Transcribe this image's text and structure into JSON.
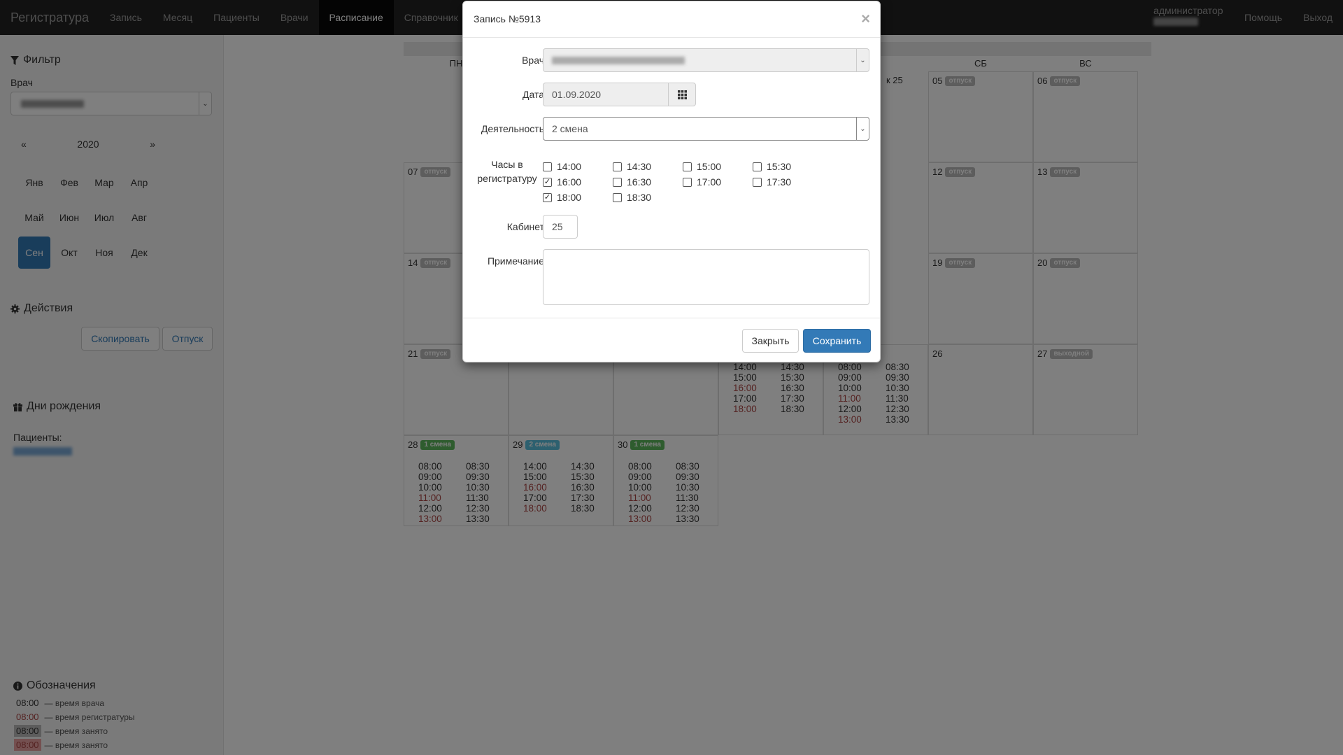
{
  "nav": {
    "brand": "Регистратура",
    "items": [
      "Запись",
      "Месяц",
      "Пациенты",
      "Врачи",
      "Расписание",
      "Справочник"
    ],
    "active": "Расписание",
    "user_role": "администратор",
    "help": "Помощь",
    "logout": "Выход"
  },
  "sidebar": {
    "filter_title": "Фильтр",
    "doctor_label": "Врач",
    "year": "2020",
    "prev": "«",
    "next": "»",
    "months": [
      "Янв",
      "Фев",
      "Мар",
      "Апр",
      "Май",
      "Июн",
      "Июл",
      "Авг",
      "Сен",
      "Окт",
      "Ноя",
      "Дек"
    ],
    "active_month": "Сен",
    "actions_title": "Действия",
    "copy_btn": "Скопировать",
    "vacation_btn": "Отпуск",
    "birthdays_title": "Дни рождения",
    "patients_label": "Пациенты:",
    "legend_title": "Обозначения",
    "legend": [
      {
        "time": "08:00",
        "text": "— время врача",
        "color": "#333333",
        "bg": ""
      },
      {
        "time": "08:00",
        "text": "— время регистратуры",
        "color": "#a94442",
        "bg": ""
      },
      {
        "time": "08:00",
        "text": "— время занято",
        "color": "#333333",
        "bg": "#bbbbbb"
      },
      {
        "time": "08:00",
        "text": "— время занято",
        "color": "#a94442",
        "bg": "#e8a0a0"
      }
    ]
  },
  "calendar": {
    "headers": [
      "ПН",
      "СБ",
      "ВС"
    ],
    "badges": {
      "vacation": "отпуск",
      "dayoff": "выходной",
      "shift1": "1 смена",
      "shift2": "2 смена"
    },
    "cells": {
      "d05": "05",
      "d06": "06",
      "d07": "07",
      "d12": "12",
      "d13": "13",
      "d14": "14",
      "d19": "19",
      "d20": "20",
      "d21": "21",
      "d26": "26",
      "d27": "27",
      "d28": "28",
      "d29": "29",
      "d30": "30",
      "partial_label": "к 25"
    },
    "shift1_times": [
      "08:00",
      "08:30",
      "09:00",
      "09:30",
      "10:00",
      "10:30",
      "11:00",
      "11:30",
      "12:00",
      "12:30",
      "13:00",
      "13:30"
    ],
    "shift2_times": [
      "14:00",
      "14:30",
      "15:00",
      "15:30",
      "16:00",
      "16:30",
      "17:00",
      "17:30",
      "18:00",
      "18:30"
    ]
  },
  "modal": {
    "title": "Запись №5913",
    "close": "×",
    "doctor_label": "Врач",
    "date_label": "Дата",
    "date_value": "01.09.2020",
    "activity_label": "Деятельность",
    "activity_value": "2 смена",
    "hours_label_1": "Часы в",
    "hours_label_2": "регистратуру",
    "hours": [
      {
        "time": "14:00",
        "checked": false
      },
      {
        "time": "14:30",
        "checked": false
      },
      {
        "time": "15:00",
        "checked": false
      },
      {
        "time": "15:30",
        "checked": false
      },
      {
        "time": "16:00",
        "checked": true
      },
      {
        "time": "16:30",
        "checked": false
      },
      {
        "time": "17:00",
        "checked": false
      },
      {
        "time": "17:30",
        "checked": false
      },
      {
        "time": "18:00",
        "checked": true
      },
      {
        "time": "18:30",
        "checked": false
      }
    ],
    "cabinet_label": "Кабинет",
    "cabinet_value": "25",
    "note_label": "Примечание",
    "close_btn": "Закрыть",
    "save_btn": "Сохранить"
  },
  "colors": {
    "primary": "#337ab7",
    "navbar": "#222222",
    "red_time": "#a94442",
    "green_badge": "#5cb85c",
    "blue_badge": "#5bc0de"
  }
}
